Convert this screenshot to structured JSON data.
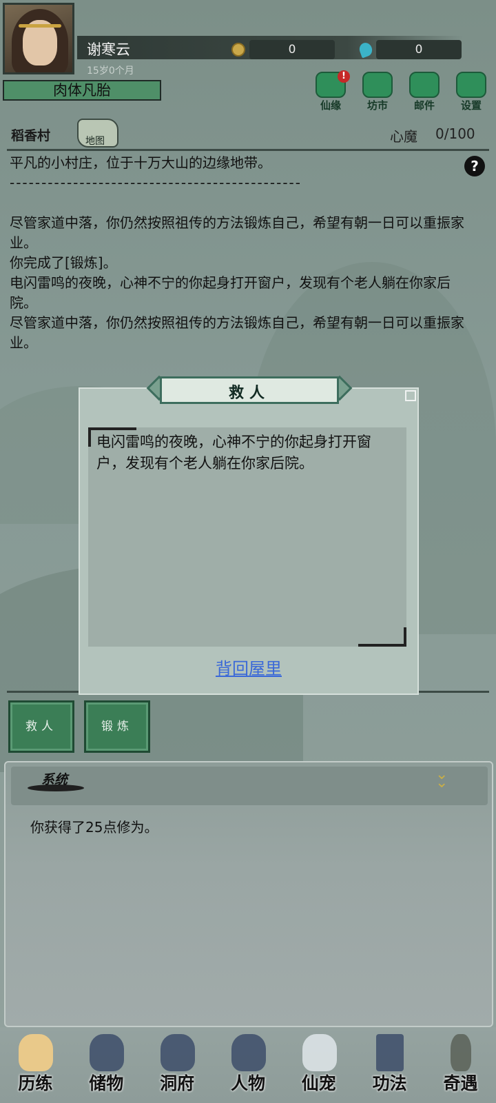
{
  "player": {
    "name": "谢寒云",
    "age": "15岁0个月",
    "realm": "肉体凡胎",
    "coins": "0",
    "gems": "0"
  },
  "top_buttons": [
    {
      "label": "仙缘",
      "icon": "immortal-fate-icon",
      "badge": "!"
    },
    {
      "label": "坊市",
      "icon": "market-icon"
    },
    {
      "label": "邮件",
      "icon": "mail-icon"
    },
    {
      "label": "设置",
      "icon": "gear-icon"
    }
  ],
  "location": {
    "name": "稻香村",
    "map_label": "地图",
    "heart_demon_label": "心魔",
    "heart_demon_value": "0/100"
  },
  "story": {
    "desc": "平凡的小村庄，位于十万大山的边缘地带。",
    "dashes": "----------------------------------------------",
    "lines": [
      "尽管家道中落，你仍然按照祖传的方法锻炼自己，希望有朝一日可以重振家业。",
      "你完成了[锻炼]。",
      "电闪雷鸣的夜晚，心神不宁的你起身打开窗户，发现有个老人躺在你家后院。",
      "尽管家道中落，你仍然按照祖传的方法锻炼自己，希望有朝一日可以重振家业。"
    ]
  },
  "dialog": {
    "title": "救人",
    "text": "电闪雷鸣的夜晚，心神不宁的你起身打开窗户，发现有个老人躺在你家后院。",
    "link": "背回屋里"
  },
  "actions": [
    "救人",
    "锻炼"
  ],
  "system": {
    "title": "系统",
    "message": "你获得了25点修为。"
  },
  "nav": [
    {
      "label": "历练",
      "icon": "training-icon",
      "active": true
    },
    {
      "label": "储物",
      "icon": "storage-bag-icon"
    },
    {
      "label": "洞府",
      "icon": "cave-residence-icon"
    },
    {
      "label": "人物",
      "icon": "character-icon"
    },
    {
      "label": "仙宠",
      "icon": "pet-icon"
    },
    {
      "label": "功法",
      "icon": "scroll-icon"
    },
    {
      "label": "奇遇",
      "icon": "adventure-icon"
    }
  ],
  "colors": {
    "realm_bar": "#4f8f68",
    "link": "#3a68d8",
    "action_button": "#3b7e56"
  }
}
